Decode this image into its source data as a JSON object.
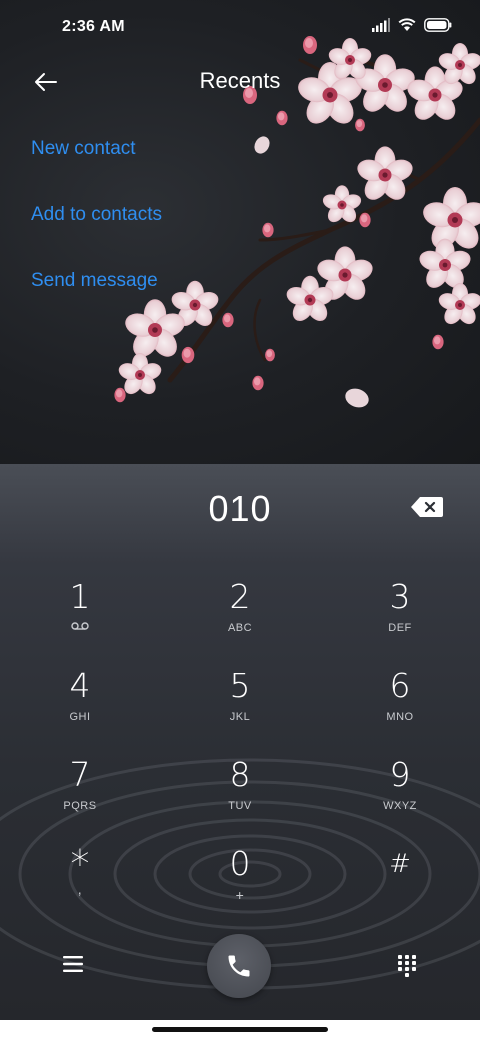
{
  "status_bar": {
    "time": "2:36 AM",
    "icons": [
      "signal-icon",
      "wifi-icon",
      "battery-icon"
    ]
  },
  "header": {
    "title": "Recents",
    "back_icon": "arrow-left-icon"
  },
  "actions": [
    {
      "label": "New contact"
    },
    {
      "label": "Add to contacts"
    },
    {
      "label": "Send message"
    }
  ],
  "dialer": {
    "number": "010",
    "backspace_icon": "backspace-icon",
    "keys": [
      {
        "digit": "1",
        "letters": ""
      },
      {
        "digit": "2",
        "letters": "ABC"
      },
      {
        "digit": "3",
        "letters": "DEF"
      },
      {
        "digit": "4",
        "letters": "GHI"
      },
      {
        "digit": "5",
        "letters": "JKL"
      },
      {
        "digit": "6",
        "letters": "MNO"
      },
      {
        "digit": "7",
        "letters": "PQRS"
      },
      {
        "digit": "8",
        "letters": "TUV"
      },
      {
        "digit": "9",
        "letters": "WXYZ"
      },
      {
        "digit": "*",
        "letters": ","
      },
      {
        "digit": "0",
        "letters": "+"
      },
      {
        "digit": "#",
        "letters": ""
      }
    ],
    "voicemail_icon": "voicemail-icon"
  },
  "bottom_bar": {
    "menu_icon": "menu-icon",
    "call_icon": "phone-icon",
    "keypad_icon": "dialpad-icon"
  },
  "colors": {
    "accent": "#2f8ef0",
    "background": "#1b1d21",
    "text": "#ffffff"
  }
}
